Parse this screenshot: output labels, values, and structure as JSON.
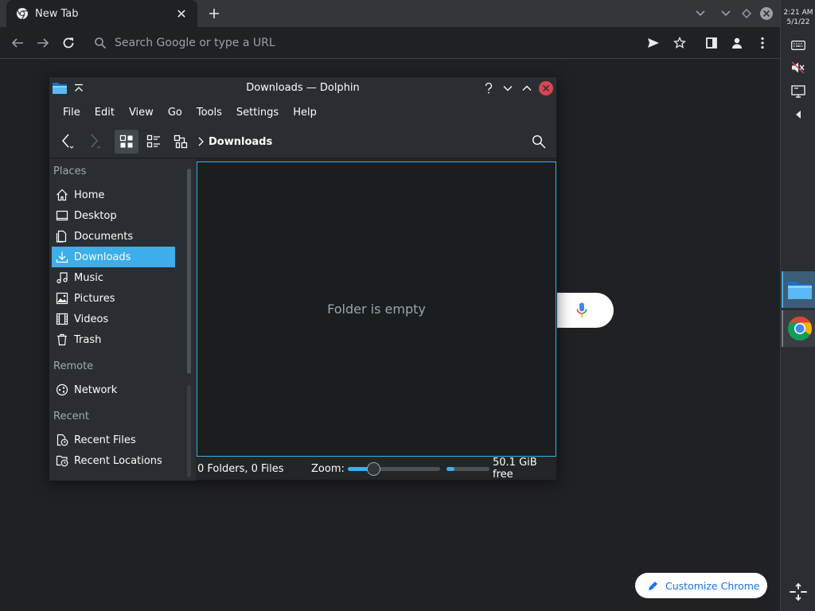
{
  "browser": {
    "tab_title": "New Tab",
    "omnibox_placeholder": "Search Google or type a URL",
    "customize_label": "Customize Chrome"
  },
  "panel": {
    "time": "2:21 AM",
    "date": "5/1/22"
  },
  "dolphin": {
    "title": "Downloads — Dolphin",
    "menu": [
      "File",
      "Edit",
      "View",
      "Go",
      "Tools",
      "Settings",
      "Help"
    ],
    "breadcrumb": "Downloads",
    "places": {
      "places_heading": "Places",
      "items": [
        {
          "label": "Home",
          "icon": "home-icon"
        },
        {
          "label": "Desktop",
          "icon": "desktop-icon"
        },
        {
          "label": "Documents",
          "icon": "documents-icon"
        },
        {
          "label": "Downloads",
          "icon": "downloads-icon",
          "selected": true
        },
        {
          "label": "Music",
          "icon": "music-icon"
        },
        {
          "label": "Pictures",
          "icon": "pictures-icon"
        },
        {
          "label": "Videos",
          "icon": "videos-icon"
        },
        {
          "label": "Trash",
          "icon": "trash-icon"
        }
      ],
      "remote_heading": "Remote",
      "remote_items": [
        {
          "label": "Network",
          "icon": "network-icon"
        }
      ],
      "recent_heading": "Recent",
      "recent_items": [
        {
          "label": "Recent Files",
          "icon": "recent-files-icon"
        },
        {
          "label": "Recent Locations",
          "icon": "recent-locations-icon"
        }
      ]
    },
    "empty_message": "Folder is empty",
    "status_count": "0 Folders, 0 Files",
    "zoom_label": "Zoom:",
    "zoom_level": 0.28,
    "disk_used_fraction": 0.18,
    "free_space": "50.1 GiB free"
  },
  "colors": {
    "accent": "#3daee9",
    "close_button": "#da4453",
    "chrome_dark": "#202124"
  }
}
